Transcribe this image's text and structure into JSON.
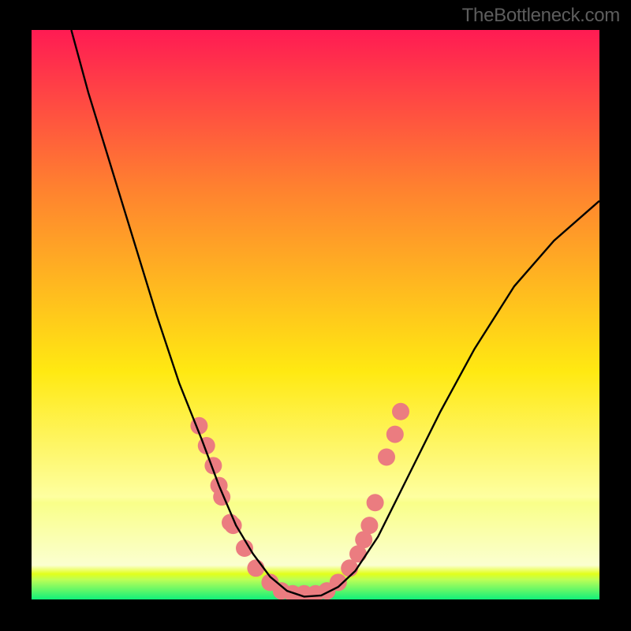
{
  "watermark": "TheBottleneck.com",
  "chart_data": {
    "type": "line",
    "title": "",
    "xlabel": "",
    "ylabel": "",
    "xlim": [
      0,
      100
    ],
    "ylim": [
      0,
      100
    ],
    "background_gradient": {
      "top": "#FF1B53",
      "mid_upper": "#FF822F",
      "mid": "#FFE912",
      "mid_lower": "#FEFFA0",
      "lower_band_top": "#F9FF89",
      "thin_bright": "#E2FF1B",
      "bottom": "#10F07A"
    },
    "series": [
      {
        "name": "curve",
        "type": "line",
        "color": "#000000",
        "points_xy": [
          [
            7,
            100
          ],
          [
            10,
            89
          ],
          [
            14,
            76
          ],
          [
            18,
            63
          ],
          [
            22,
            50
          ],
          [
            26,
            38
          ],
          [
            30,
            28
          ],
          [
            33,
            20
          ],
          [
            36,
            13
          ],
          [
            39,
            8
          ],
          [
            42,
            4
          ],
          [
            45,
            1.5
          ],
          [
            48,
            0.5
          ],
          [
            51,
            0.7
          ],
          [
            54,
            2.2
          ],
          [
            57,
            5
          ],
          [
            61,
            11
          ],
          [
            66,
            21
          ],
          [
            72,
            33
          ],
          [
            78,
            44
          ],
          [
            85,
            55
          ],
          [
            92,
            63
          ],
          [
            100,
            70
          ]
        ]
      },
      {
        "name": "dots",
        "type": "scatter",
        "color": "#EB7C80",
        "radius": 11,
        "points_xy": [
          [
            29.5,
            30.5
          ],
          [
            30.8,
            27
          ],
          [
            32,
            23.5
          ],
          [
            33,
            20
          ],
          [
            33.5,
            18
          ],
          [
            35,
            13.5
          ],
          [
            35.5,
            13
          ],
          [
            37.5,
            9
          ],
          [
            39.5,
            5.5
          ],
          [
            42,
            3
          ],
          [
            44,
            1.5
          ],
          [
            46,
            1
          ],
          [
            48,
            1
          ],
          [
            50,
            1
          ],
          [
            52,
            1.5
          ],
          [
            54,
            3
          ],
          [
            56,
            5.5
          ],
          [
            57.5,
            8
          ],
          [
            58.5,
            10.5
          ],
          [
            59.5,
            13
          ],
          [
            60.5,
            17
          ],
          [
            62.5,
            25
          ],
          [
            64,
            29
          ],
          [
            65,
            33
          ]
        ]
      }
    ]
  }
}
